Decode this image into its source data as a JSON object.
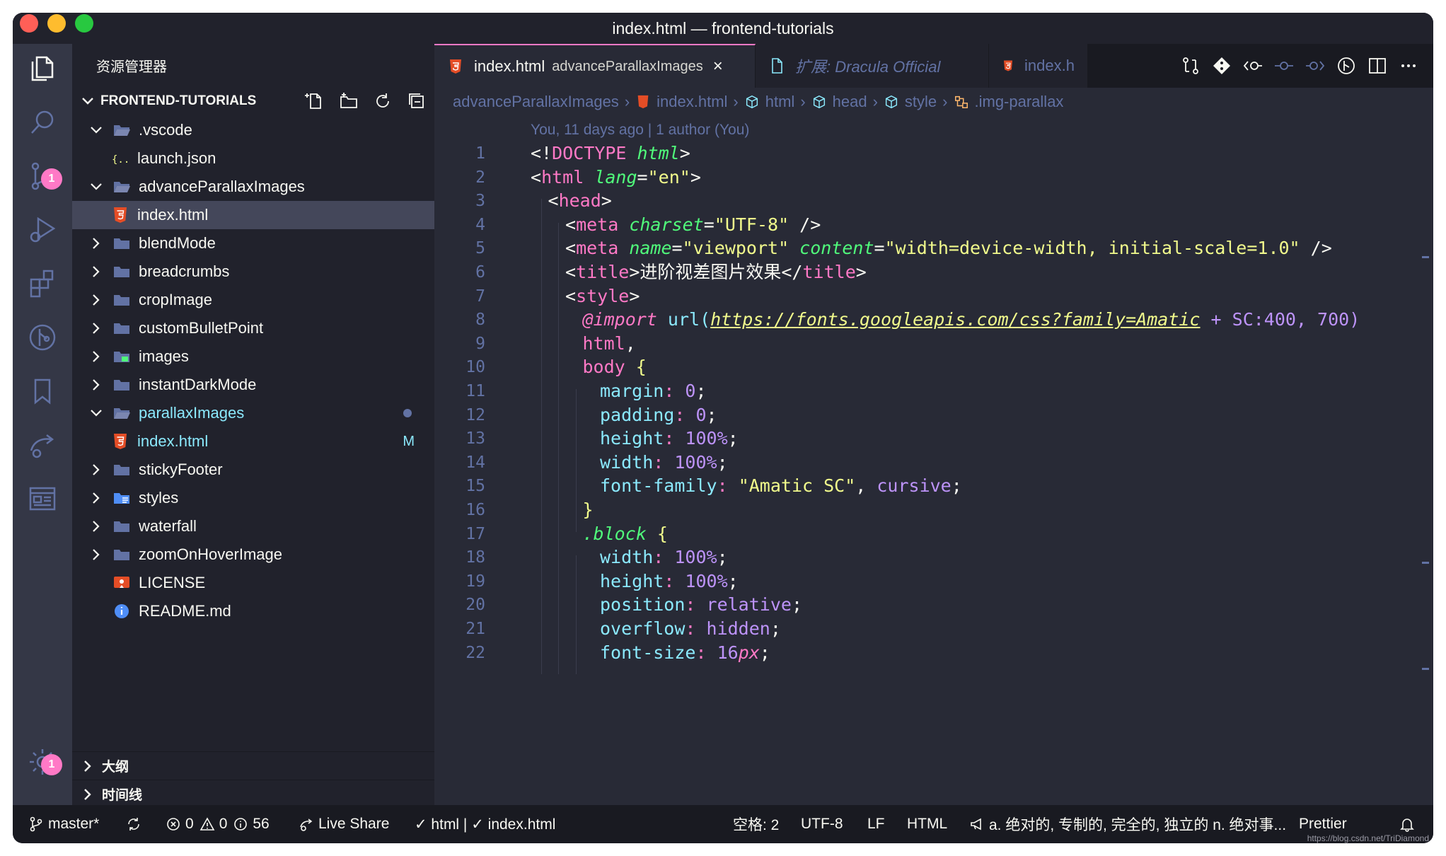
{
  "window": {
    "title": "index.html — frontend-tutorials"
  },
  "activity_bar": {
    "items": [
      {
        "name": "explorer-icon"
      },
      {
        "name": "search-icon"
      },
      {
        "name": "source-control-icon",
        "badge": "1"
      },
      {
        "name": "run-debug-icon"
      },
      {
        "name": "extensions-icon"
      },
      {
        "name": "git-graph-icon"
      },
      {
        "name": "bookmark-icon"
      },
      {
        "name": "live-share-icon"
      },
      {
        "name": "browser-preview-icon"
      },
      {
        "name": "gear-icon",
        "badge": "1"
      }
    ]
  },
  "sidebar": {
    "title": "资源管理器",
    "section": "FRONTEND-TUTORIALS",
    "tree": [
      {
        "label": ".vscode",
        "type": "folder-open",
        "indent": 1
      },
      {
        "label": "launch.json",
        "type": "json",
        "indent": 2
      },
      {
        "label": "advanceParallaxImages",
        "type": "folder-open",
        "indent": 1
      },
      {
        "label": "index.html",
        "type": "html",
        "indent": 2,
        "selected": true
      },
      {
        "label": "blendMode",
        "type": "folder",
        "indent": 1
      },
      {
        "label": "breadcrumbs",
        "type": "folder",
        "indent": 1
      },
      {
        "label": "cropImage",
        "type": "folder",
        "indent": 1
      },
      {
        "label": "customBulletPoint",
        "type": "folder",
        "indent": 1
      },
      {
        "label": "images",
        "type": "folder-images",
        "indent": 1
      },
      {
        "label": "instantDarkMode",
        "type": "folder",
        "indent": 1
      },
      {
        "label": "parallaxImages",
        "type": "folder-open",
        "indent": 1,
        "modified": true
      },
      {
        "label": "index.html",
        "type": "html",
        "indent": 2,
        "modified": true,
        "badge": "M"
      },
      {
        "label": "stickyFooter",
        "type": "folder",
        "indent": 1
      },
      {
        "label": "styles",
        "type": "folder-styles",
        "indent": 1
      },
      {
        "label": "waterfall",
        "type": "folder",
        "indent": 1
      },
      {
        "label": "zoomOnHoverImage",
        "type": "folder",
        "indent": 1
      },
      {
        "label": "LICENSE",
        "type": "license",
        "indent": 1
      },
      {
        "label": "README.md",
        "type": "readme",
        "indent": 1
      }
    ],
    "outline_label": "大纲",
    "timeline_label": "时间线"
  },
  "tabs": [
    {
      "label": "index.html",
      "sub": "advanceParallaxImages",
      "active": true
    },
    {
      "label": "扩展: Dracula Official",
      "active": false
    },
    {
      "label": "index.h",
      "active": false
    }
  ],
  "breadcrumbs": [
    "advanceParallaxImages",
    "index.html",
    "html",
    "head",
    "style",
    ".img-parallax"
  ],
  "blame": "You, 11 days ago | 1 author (You)",
  "code_lines": [
    {
      "n": "1"
    },
    {
      "n": "2"
    },
    {
      "n": "3"
    },
    {
      "n": "4"
    },
    {
      "n": "5"
    },
    {
      "n": "6"
    },
    {
      "n": "7"
    },
    {
      "n": "8"
    },
    {
      "n": "9"
    },
    {
      "n": "10"
    },
    {
      "n": "11"
    },
    {
      "n": "12"
    },
    {
      "n": "13"
    },
    {
      "n": "14"
    },
    {
      "n": "15"
    },
    {
      "n": "16"
    },
    {
      "n": "17"
    },
    {
      "n": "18"
    },
    {
      "n": "19"
    },
    {
      "n": "20"
    },
    {
      "n": "21"
    },
    {
      "n": "22"
    }
  ],
  "code_text": {
    "l1a": "<!",
    "l1b": "DOCTYPE",
    "l1c": " html",
    "l1d": ">",
    "l2a": "<",
    "l2b": "html",
    "l2c": " lang",
    "l2d": "=",
    "l2e": "\"en\"",
    "l2f": ">",
    "l3a": "<",
    "l3b": "head",
    "l3c": ">",
    "l4a": "<",
    "l4b": "meta",
    "l4c": " charset",
    "l4d": "=",
    "l4e": "\"UTF-8\"",
    "l4f": " />",
    "l5a": "<",
    "l5b": "meta",
    "l5c": " name",
    "l5d": "=",
    "l5e": "\"viewport\"",
    "l5f": " content",
    "l5g": "=",
    "l5h": "\"width=device-width, initial-scale=1.0\"",
    "l5i": " />",
    "l6a": "<",
    "l6b": "title",
    "l6c": ">进阶视差图片效果</",
    "l6d": "title",
    "l6e": ">",
    "l7a": "<",
    "l7b": "style",
    "l7c": ">",
    "l8a": "@import",
    "l8b": " url(",
    "l8c": "https://fonts.googleapis.com/css?family=Amatic",
    "l8d": " + SC:400, 700)",
    "l9a": "html",
    "l9b": ",",
    "l10a": "body",
    "l10b": " {",
    "l11a": "margin",
    "l11b": ": ",
    "l11c": "0",
    "l11d": ";",
    "l12a": "padding",
    "l12b": ": ",
    "l12c": "0",
    "l12d": ";",
    "l13a": "height",
    "l13b": ": ",
    "l13c": "100%",
    "l13d": ";",
    "l14a": "width",
    "l14b": ": ",
    "l14c": "100%",
    "l14d": ";",
    "l15a": "font-family",
    "l15b": ": ",
    "l15c": "\"Amatic SC\"",
    "l15d": ", ",
    "l15e": "cursive",
    "l15f": ";",
    "l16a": "}",
    "l17a": ".block",
    "l17b": " {",
    "l18a": "width",
    "l18b": ": ",
    "l18c": "100%",
    "l18d": ";",
    "l19a": "height",
    "l19b": ": ",
    "l19c": "100%",
    "l19d": ";",
    "l20a": "position",
    "l20b": ": ",
    "l20c": "relative",
    "l20d": ";",
    "l21a": "overflow",
    "l21b": ": ",
    "l21c": "hidden",
    "l21d": ";",
    "l22a": "font-size",
    "l22b": ": ",
    "l22c": "16",
    "l22d": "px",
    "l22e": ";"
  },
  "statusbar": {
    "branch": "master*",
    "errors": "0",
    "warnings": "0",
    "infos": "56",
    "live_share": "Live Share",
    "lint": "✓ html | ✓ index.html",
    "spaces": "空格: 2",
    "encoding": "UTF-8",
    "eol": "LF",
    "language": "HTML",
    "translation": "a. 绝对的, 专制的, 完全的, 独立的 n. 绝对事...",
    "formatter": "Prettier",
    "watermark": "https://blog.csdn.net/TriDiamond"
  },
  "colors": {
    "background": "#282a36",
    "sidebar": "#21222c",
    "accent_pink": "#ff79c6",
    "green": "#50fa7b",
    "cyan": "#8be9fd",
    "yellow": "#f1fa8c",
    "purple": "#bd93f9",
    "comment": "#6272a4"
  }
}
